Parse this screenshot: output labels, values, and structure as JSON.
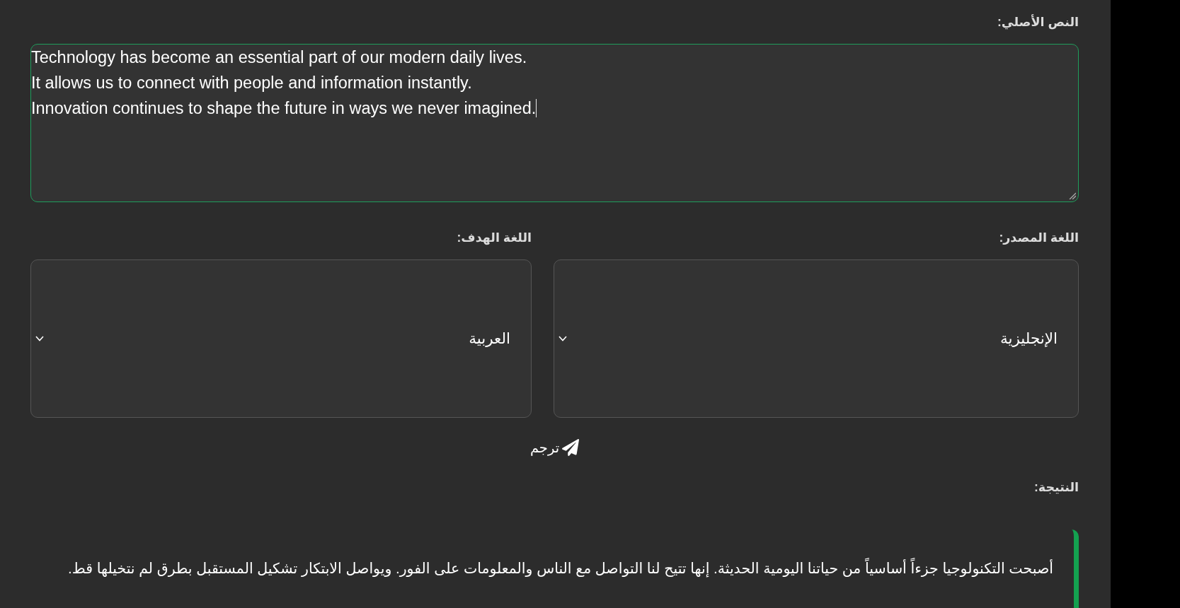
{
  "source_text": {
    "label": "النص الأصلي:",
    "value": "Technology has become an essential part of our modern daily lives.\nIt allows us to connect with people and information instantly.\nInnovation continues to shape the future in ways we never imagined.",
    "focused": true
  },
  "languages": [
    {
      "label": "اللغة المصدر:",
      "value": "الإنجليزية"
    },
    {
      "label": "اللغة الهدف:",
      "value": "العربية"
    }
  ],
  "translate_button": {
    "label": "ترجم"
  },
  "result": {
    "label": "النتيجة:",
    "text": "أصبحت التكنولوجيا جزءاً أساسياً من حياتنا اليومية الحديثة. إنها تتيح لنا التواصل مع الناس والمعلومات على الفور. ويواصل الابتكار تشكيل المستقبل بطرق لم نتخيلها قط."
  }
}
